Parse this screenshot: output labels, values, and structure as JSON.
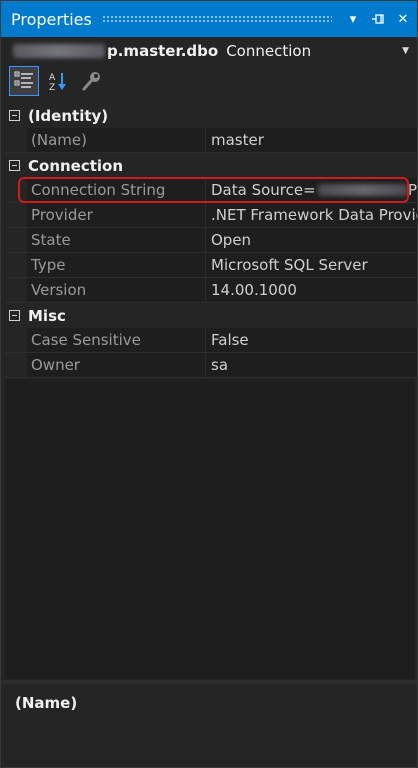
{
  "window": {
    "title": "Properties",
    "buttons": {
      "dropdown": "▾",
      "pin": "⊣",
      "close": "✕"
    }
  },
  "selector": {
    "object_name": "p.master.dbo",
    "object_type": "Connection"
  },
  "toolbar": {
    "categorized_icon": "categorized-view-icon",
    "alphabetical_icon": "alphabetical-sort-icon",
    "property_pages_icon": "wrench-icon"
  },
  "categories": [
    {
      "label": "(Identity)",
      "properties": [
        {
          "name": "(Name)",
          "value": "master"
        }
      ]
    },
    {
      "label": "Connection",
      "properties": [
        {
          "name": "Connection String",
          "value": "Data Source=",
          "value_suffix": "P"
        },
        {
          "name": "Provider",
          "value": ".NET Framework Data Provid"
        },
        {
          "name": "State",
          "value": "Open"
        },
        {
          "name": "Type",
          "value": "Microsoft SQL Server"
        },
        {
          "name": "Version",
          "value": "14.00.1000"
        }
      ]
    },
    {
      "label": "Misc",
      "properties": [
        {
          "name": "Case Sensitive",
          "value": "False"
        },
        {
          "name": "Owner",
          "value": "sa"
        }
      ]
    }
  ],
  "description": {
    "title": "(Name)"
  },
  "colors": {
    "accent": "#007acc",
    "highlight": "#d11a1a",
    "background": "#252526"
  }
}
